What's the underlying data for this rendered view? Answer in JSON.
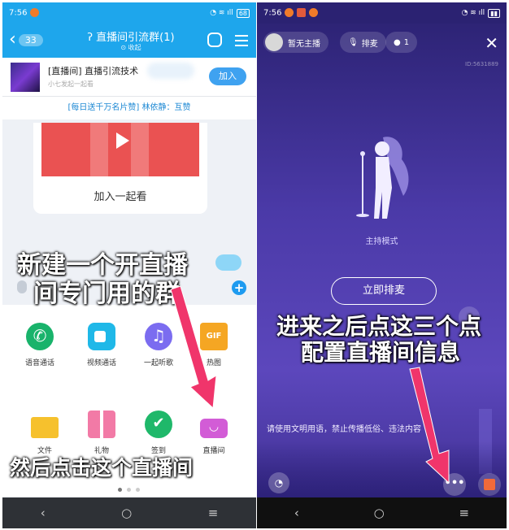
{
  "left_phone": {
    "status": {
      "time": "7:56",
      "battery": "68"
    },
    "header": {
      "back_count": "33",
      "title": "直播间引流群(1)",
      "subtitle": "收起"
    },
    "group_card": {
      "name": "[直播间] 直播引流技术",
      "sub": "小七发起一起看",
      "join_label": "加入"
    },
    "banner": "[每日送千万名片赞] 林依静：互赞",
    "video_card": {
      "label": "加入一起看"
    },
    "grid": [
      {
        "label": "语音通话",
        "icon": "phone-icon"
      },
      {
        "label": "视频通话",
        "icon": "video-call-icon"
      },
      {
        "label": "一起听歌",
        "icon": "music-icon"
      },
      {
        "label": "热图",
        "icon": "gif-icon"
      },
      {
        "label": "文件",
        "icon": "folder-icon"
      },
      {
        "label": "礼物",
        "icon": "gift-icon"
      },
      {
        "label": "签到",
        "icon": "checkin-icon"
      },
      {
        "label": "直播间",
        "icon": "live-room-icon"
      }
    ],
    "nav": {
      "back": "‹",
      "home": "○",
      "menu": "≡"
    }
  },
  "right_phone": {
    "status": {
      "time": "7:56"
    },
    "host_label": "暂无主播",
    "queue_pill": "排麦",
    "audience_count": "1",
    "room_id": "ID:5631889",
    "mode_label": "主持模式",
    "queue_button": "立即排麦",
    "notice": "请使用文明用语，禁止传播低俗、违法内容",
    "more_label": "•••",
    "nav": {
      "back": "‹",
      "home": "○",
      "menu": "≡"
    }
  },
  "annotations": {
    "left_top_line1": "新建一个开直播",
    "left_top_line2": "间专门用的群",
    "left_bottom": "然后点击这个直播间",
    "right_line1": "进来之后点这三个点",
    "right_line2": "配置直播间信息"
  },
  "colors": {
    "qq_blue": "#1ea6ec",
    "arrow": "#f0356b",
    "room_purple": "#4b3aa8"
  }
}
